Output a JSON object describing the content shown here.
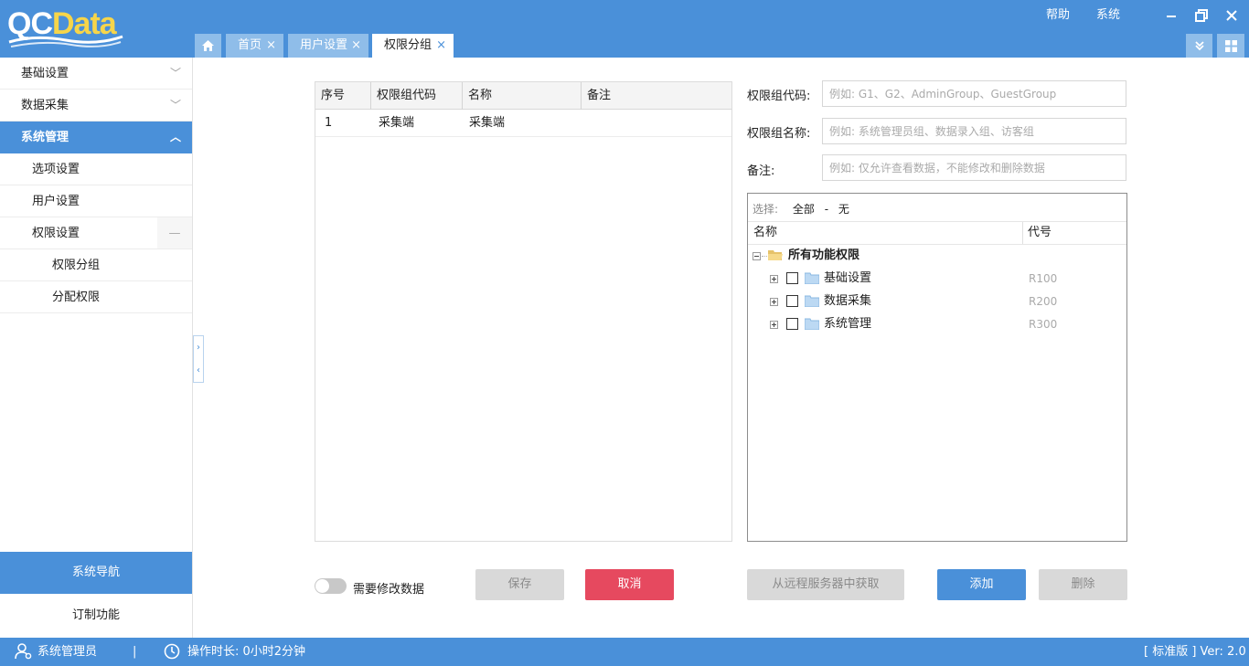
{
  "app": {
    "logo_text_part1": "QC",
    "logo_text_part2": "Data",
    "brand_color": "#4a90d9",
    "logo_accent_color": "#f6d54a"
  },
  "header": {
    "help_label": "帮助",
    "system_label": "系统",
    "window_controls": [
      "minimize-icon",
      "restore-icon",
      "close-icon"
    ]
  },
  "tabs": [
    {
      "label": "首页",
      "close": "×",
      "active": false
    },
    {
      "label": "用户设置",
      "close": "×",
      "active": false
    },
    {
      "label": "权限分组",
      "close": "×",
      "active": true
    }
  ],
  "sidebar": {
    "items": [
      {
        "label": "基础设置",
        "expanded": false
      },
      {
        "label": "数据采集",
        "expanded": false
      },
      {
        "label": "系统管理",
        "expanded": true,
        "active": true
      },
      {
        "label": "选项设置"
      },
      {
        "label": "用户设置"
      },
      {
        "label": "权限设置",
        "expanded": true
      },
      {
        "label": "权限分组"
      },
      {
        "label": "分配权限"
      }
    ],
    "system_nav_label": "系统导航",
    "custom_features_label": "订制功能"
  },
  "grid": {
    "columns": [
      "序号",
      "权限组代码",
      "名称",
      "备注"
    ],
    "rows": [
      {
        "index": "1",
        "code": "采集端",
        "name": "采集端",
        "remark": ""
      }
    ]
  },
  "form": {
    "code_label": "权限组代码:",
    "code_placeholder": "例如: G1、G2、AdminGroup、GuestGroup",
    "name_label": "权限组名称:",
    "name_placeholder": "例如: 系统管理员组、数据录入组、访客组",
    "remark_label": "备注:",
    "remark_placeholder": "例如: 仅允许查看数据，不能修改和删除数据"
  },
  "tree": {
    "select_label": "选择:",
    "select_all": "全部",
    "select_sep": "-",
    "select_none": "无",
    "col_name": "名称",
    "col_code": "代号",
    "root_label": "所有功能权限",
    "nodes": [
      {
        "label": "基础设置",
        "code": "R100"
      },
      {
        "label": "数据采集",
        "code": "R200"
      },
      {
        "label": "系统管理",
        "code": "R300"
      }
    ]
  },
  "actions": {
    "toggle_label": "需要修改数据",
    "toggle_on": false,
    "save_label": "保存",
    "cancel_label": "取消",
    "fetch_remote_label": "从远程服务器中获取",
    "add_label": "添加",
    "delete_label": "删除"
  },
  "status": {
    "user": "系统管理员",
    "separator": "|",
    "duration": "操作时长: 0小时2分钟",
    "version": "[ 标准版 ] Ver: 2.0"
  }
}
